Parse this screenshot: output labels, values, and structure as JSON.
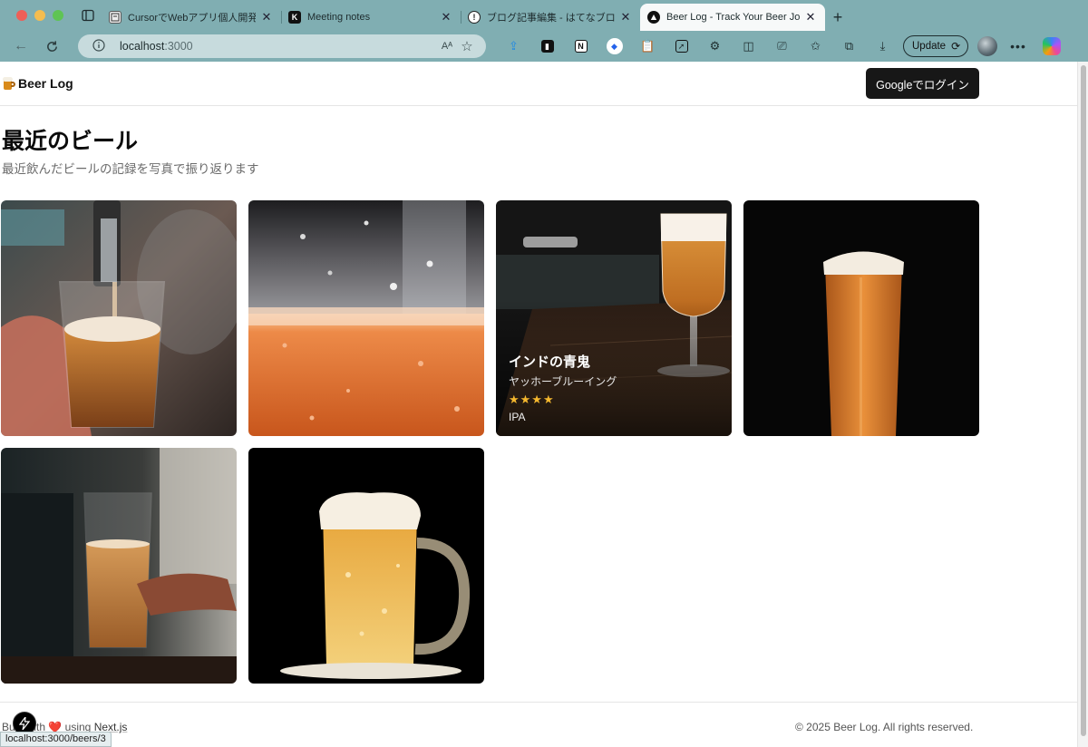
{
  "browser": {
    "tabs": [
      {
        "title": "CursorでWebアプリ個人開発メモ",
        "icon": "notebook-favicon-icon",
        "active": false
      },
      {
        "title": "Meeting notes",
        "icon": "k-favicon-icon",
        "active": false
      },
      {
        "title": "ブログ記事編集 - はてなブログ",
        "icon": "hatena-favicon-icon",
        "active": false
      },
      {
        "title": "Beer Log - Track Your Beer Jou",
        "icon": "vercel-favicon-icon",
        "active": true
      }
    ],
    "address": {
      "host": "localhost",
      "port": ":3000"
    },
    "update_label": "Update",
    "status_url": "localhost:3000/beers/3"
  },
  "site": {
    "brand": "Beer Log",
    "login_label": "Googleでログイン"
  },
  "main": {
    "title": "最近のビール",
    "subtitle": "最近飲んだビールの記録を写真で振り返ります"
  },
  "beers": [
    {
      "image": "beer-pouring-tap-photo"
    },
    {
      "image": "beer-glass-closeup-photo"
    },
    {
      "image": "ipa-glass-bar-photo",
      "name": "インドの青鬼",
      "brewery": "ヤッホーブルーイング",
      "rating": 4,
      "stars": "★★★★",
      "style": "IPA"
    },
    {
      "image": "lager-pint-dark-photo"
    },
    {
      "image": "beer-held-hand-photo"
    },
    {
      "image": "beer-mug-foam-photo"
    }
  ],
  "footer": {
    "built_prefix": "Built with",
    "heart": "❤️",
    "using": "using",
    "link": "Next.js",
    "copyright": "© 2025 Beer Log. All rights reserved."
  }
}
